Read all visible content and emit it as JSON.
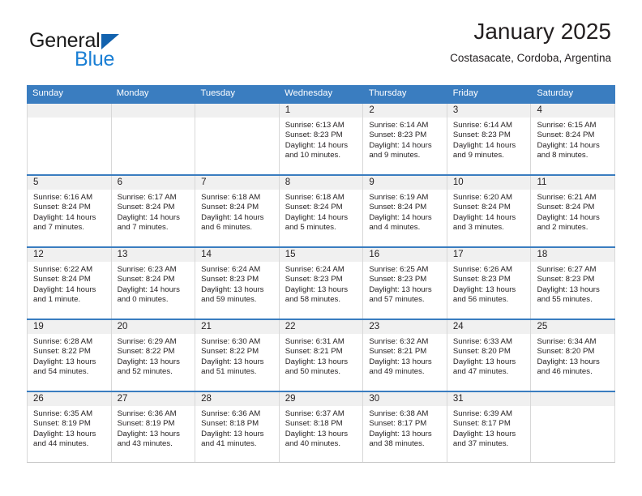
{
  "brand": {
    "name_part1": "General",
    "name_part2": "Blue",
    "accent_color": "#1b7fd4",
    "triangle_color": "#1262ae"
  },
  "header": {
    "title": "January 2025",
    "subtitle": "Costasacate, Cordoba, Argentina"
  },
  "calendar": {
    "header_color": "#3a7dc0",
    "weekday_headers": [
      "Sunday",
      "Monday",
      "Tuesday",
      "Wednesday",
      "Thursday",
      "Friday",
      "Saturday"
    ],
    "weeks": [
      [
        {
          "day": "",
          "sunrise": "",
          "sunset": "",
          "daylight": ""
        },
        {
          "day": "",
          "sunrise": "",
          "sunset": "",
          "daylight": ""
        },
        {
          "day": "",
          "sunrise": "",
          "sunset": "",
          "daylight": ""
        },
        {
          "day": "1",
          "sunrise": "Sunrise: 6:13 AM",
          "sunset": "Sunset: 8:23 PM",
          "daylight": "Daylight: 14 hours and 10 minutes."
        },
        {
          "day": "2",
          "sunrise": "Sunrise: 6:14 AM",
          "sunset": "Sunset: 8:23 PM",
          "daylight": "Daylight: 14 hours and 9 minutes."
        },
        {
          "day": "3",
          "sunrise": "Sunrise: 6:14 AM",
          "sunset": "Sunset: 8:23 PM",
          "daylight": "Daylight: 14 hours and 9 minutes."
        },
        {
          "day": "4",
          "sunrise": "Sunrise: 6:15 AM",
          "sunset": "Sunset: 8:24 PM",
          "daylight": "Daylight: 14 hours and 8 minutes."
        }
      ],
      [
        {
          "day": "5",
          "sunrise": "Sunrise: 6:16 AM",
          "sunset": "Sunset: 8:24 PM",
          "daylight": "Daylight: 14 hours and 7 minutes."
        },
        {
          "day": "6",
          "sunrise": "Sunrise: 6:17 AM",
          "sunset": "Sunset: 8:24 PM",
          "daylight": "Daylight: 14 hours and 7 minutes."
        },
        {
          "day": "7",
          "sunrise": "Sunrise: 6:18 AM",
          "sunset": "Sunset: 8:24 PM",
          "daylight": "Daylight: 14 hours and 6 minutes."
        },
        {
          "day": "8",
          "sunrise": "Sunrise: 6:18 AM",
          "sunset": "Sunset: 8:24 PM",
          "daylight": "Daylight: 14 hours and 5 minutes."
        },
        {
          "day": "9",
          "sunrise": "Sunrise: 6:19 AM",
          "sunset": "Sunset: 8:24 PM",
          "daylight": "Daylight: 14 hours and 4 minutes."
        },
        {
          "day": "10",
          "sunrise": "Sunrise: 6:20 AM",
          "sunset": "Sunset: 8:24 PM",
          "daylight": "Daylight: 14 hours and 3 minutes."
        },
        {
          "day": "11",
          "sunrise": "Sunrise: 6:21 AM",
          "sunset": "Sunset: 8:24 PM",
          "daylight": "Daylight: 14 hours and 2 minutes."
        }
      ],
      [
        {
          "day": "12",
          "sunrise": "Sunrise: 6:22 AM",
          "sunset": "Sunset: 8:24 PM",
          "daylight": "Daylight: 14 hours and 1 minute."
        },
        {
          "day": "13",
          "sunrise": "Sunrise: 6:23 AM",
          "sunset": "Sunset: 8:24 PM",
          "daylight": "Daylight: 14 hours and 0 minutes."
        },
        {
          "day": "14",
          "sunrise": "Sunrise: 6:24 AM",
          "sunset": "Sunset: 8:23 PM",
          "daylight": "Daylight: 13 hours and 59 minutes."
        },
        {
          "day": "15",
          "sunrise": "Sunrise: 6:24 AM",
          "sunset": "Sunset: 8:23 PM",
          "daylight": "Daylight: 13 hours and 58 minutes."
        },
        {
          "day": "16",
          "sunrise": "Sunrise: 6:25 AM",
          "sunset": "Sunset: 8:23 PM",
          "daylight": "Daylight: 13 hours and 57 minutes."
        },
        {
          "day": "17",
          "sunrise": "Sunrise: 6:26 AM",
          "sunset": "Sunset: 8:23 PM",
          "daylight": "Daylight: 13 hours and 56 minutes."
        },
        {
          "day": "18",
          "sunrise": "Sunrise: 6:27 AM",
          "sunset": "Sunset: 8:23 PM",
          "daylight": "Daylight: 13 hours and 55 minutes."
        }
      ],
      [
        {
          "day": "19",
          "sunrise": "Sunrise: 6:28 AM",
          "sunset": "Sunset: 8:22 PM",
          "daylight": "Daylight: 13 hours and 54 minutes."
        },
        {
          "day": "20",
          "sunrise": "Sunrise: 6:29 AM",
          "sunset": "Sunset: 8:22 PM",
          "daylight": "Daylight: 13 hours and 52 minutes."
        },
        {
          "day": "21",
          "sunrise": "Sunrise: 6:30 AM",
          "sunset": "Sunset: 8:22 PM",
          "daylight": "Daylight: 13 hours and 51 minutes."
        },
        {
          "day": "22",
          "sunrise": "Sunrise: 6:31 AM",
          "sunset": "Sunset: 8:21 PM",
          "daylight": "Daylight: 13 hours and 50 minutes."
        },
        {
          "day": "23",
          "sunrise": "Sunrise: 6:32 AM",
          "sunset": "Sunset: 8:21 PM",
          "daylight": "Daylight: 13 hours and 49 minutes."
        },
        {
          "day": "24",
          "sunrise": "Sunrise: 6:33 AM",
          "sunset": "Sunset: 8:20 PM",
          "daylight": "Daylight: 13 hours and 47 minutes."
        },
        {
          "day": "25",
          "sunrise": "Sunrise: 6:34 AM",
          "sunset": "Sunset: 8:20 PM",
          "daylight": "Daylight: 13 hours and 46 minutes."
        }
      ],
      [
        {
          "day": "26",
          "sunrise": "Sunrise: 6:35 AM",
          "sunset": "Sunset: 8:19 PM",
          "daylight": "Daylight: 13 hours and 44 minutes."
        },
        {
          "day": "27",
          "sunrise": "Sunrise: 6:36 AM",
          "sunset": "Sunset: 8:19 PM",
          "daylight": "Daylight: 13 hours and 43 minutes."
        },
        {
          "day": "28",
          "sunrise": "Sunrise: 6:36 AM",
          "sunset": "Sunset: 8:18 PM",
          "daylight": "Daylight: 13 hours and 41 minutes."
        },
        {
          "day": "29",
          "sunrise": "Sunrise: 6:37 AM",
          "sunset": "Sunset: 8:18 PM",
          "daylight": "Daylight: 13 hours and 40 minutes."
        },
        {
          "day": "30",
          "sunrise": "Sunrise: 6:38 AM",
          "sunset": "Sunset: 8:17 PM",
          "daylight": "Daylight: 13 hours and 38 minutes."
        },
        {
          "day": "31",
          "sunrise": "Sunrise: 6:39 AM",
          "sunset": "Sunset: 8:17 PM",
          "daylight": "Daylight: 13 hours and 37 minutes."
        },
        {
          "day": "",
          "sunrise": "",
          "sunset": "",
          "daylight": ""
        }
      ]
    ]
  }
}
